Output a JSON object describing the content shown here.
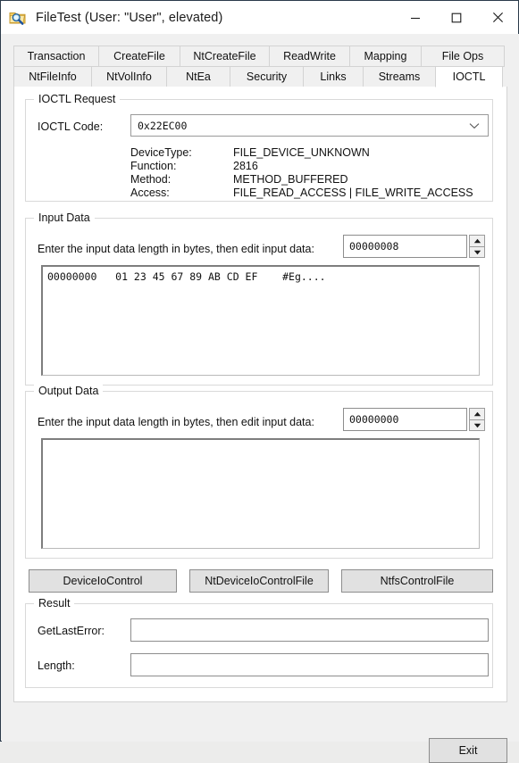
{
  "window": {
    "title": "FileTest (User: \"User\", elevated)",
    "icon": "folder-search-icon",
    "minimize_label": "—",
    "maximize_label": "□",
    "close_label": "✕"
  },
  "tabs": {
    "row1": [
      {
        "label": "Transaction",
        "selected": false
      },
      {
        "label": "CreateFile",
        "selected": false
      },
      {
        "label": "NtCreateFile",
        "selected": false
      },
      {
        "label": "ReadWrite",
        "selected": false
      },
      {
        "label": "Mapping",
        "selected": false
      },
      {
        "label": "File Ops",
        "selected": false
      }
    ],
    "row2": [
      {
        "label": "NtFileInfo",
        "selected": false
      },
      {
        "label": "NtVolInfo",
        "selected": false
      },
      {
        "label": "NtEa",
        "selected": false
      },
      {
        "label": "Security",
        "selected": false
      },
      {
        "label": "Links",
        "selected": false
      },
      {
        "label": "Streams",
        "selected": false
      },
      {
        "label": "IOCTL",
        "selected": true
      }
    ]
  },
  "ioctl_request": {
    "legend": "IOCTL Request",
    "code_label": "IOCTL Code:",
    "code_value": "0x22EC00",
    "details": [
      {
        "key": "DeviceType:",
        "value": "FILE_DEVICE_UNKNOWN"
      },
      {
        "key": "Function:",
        "value": "2816"
      },
      {
        "key": "Method:",
        "value": "METHOD_BUFFERED"
      },
      {
        "key": "Access:",
        "value": "FILE_READ_ACCESS | FILE_WRITE_ACCESS"
      }
    ]
  },
  "input_data": {
    "legend": "Input Data",
    "length_label": "Enter the input data length in bytes, then edit input data:",
    "length_value": "00000008",
    "spin_up": "▲",
    "spin_down": "▼",
    "hex_lines": [
      "00000000   01 23 45 67 89 AB CD EF    #Eg...."
    ]
  },
  "output_data": {
    "legend": "Output Data",
    "length_label": "Enter the input data length in bytes, then edit input data:",
    "length_value": "00000000",
    "spin_up": "▲",
    "spin_down": "▼",
    "hex_lines": []
  },
  "action_buttons": [
    {
      "label": "DeviceIoControl"
    },
    {
      "label": "NtDeviceIoControlFile"
    },
    {
      "label": "NtfsControlFile"
    }
  ],
  "result": {
    "legend": "Result",
    "last_error_label": "GetLastError:",
    "last_error_value": "",
    "length_label": "Length:",
    "length_value": ""
  },
  "footer": {
    "exit_label": "Exit"
  },
  "colors": {
    "window_border": "#2b3a4a",
    "client_bg": "#f0f0f0",
    "panel_bg": "#ffffff",
    "button_face": "#e1e1e1",
    "group_border": "#d9d9d9",
    "text": "#111111"
  }
}
